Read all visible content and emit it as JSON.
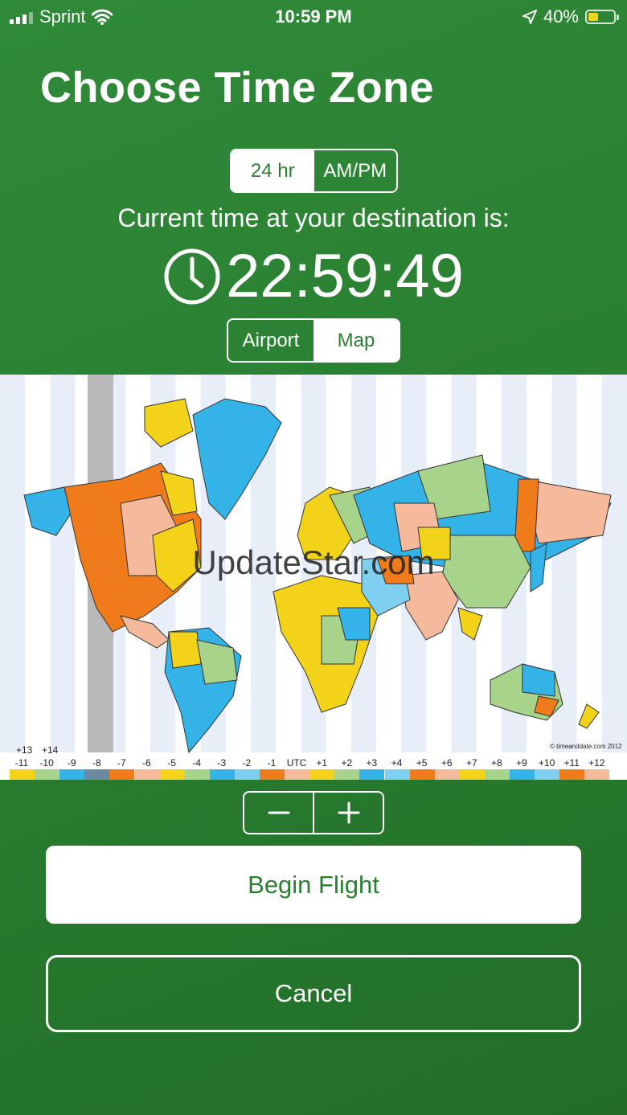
{
  "status_bar": {
    "carrier": "Sprint",
    "time": "10:59 PM",
    "battery_percent": "40%",
    "battery_level": 0.4,
    "icons": [
      "signal-bars-icon",
      "wifi-icon",
      "location-arrow-icon",
      "battery-icon"
    ]
  },
  "title": "Choose Time Zone",
  "format_toggle": {
    "options": [
      "24 hr",
      "AM/PM"
    ],
    "selected": "24 hr"
  },
  "destination_label": "Current time at your destination is:",
  "current_time": "22:59:49",
  "source_toggle": {
    "options": [
      "Airport",
      "Map"
    ],
    "selected": "Map"
  },
  "map": {
    "watermark": "UpdateStar.com",
    "credit": "© timeanddate.com 2012",
    "extra_offsets": [
      "+13",
      "+14"
    ],
    "offsets": [
      "-11",
      "-10",
      "-9",
      "-8",
      "-7",
      "-6",
      "-5",
      "-4",
      "-3",
      "-2",
      "-1",
      "UTC",
      "+1",
      "+2",
      "+3",
      "+4",
      "+5",
      "+6",
      "+7",
      "+8",
      "+9",
      "+10",
      "+11",
      "+12"
    ],
    "offset_colors": [
      "#f3d21a",
      "#a7d38a",
      "#33b3e8",
      "#6b8aa0",
      "#ef7b1a",
      "#f5b99b",
      "#f3d21a",
      "#a7d38a",
      "#33b3e8",
      "#7fcff0",
      "#ef7b1a",
      "#f5b99b",
      "#f3d21a",
      "#a7d38a",
      "#33b3e8",
      "#7fcff0",
      "#ef7b1a",
      "#f5b99b",
      "#f3d21a",
      "#a7d38a",
      "#33b3e8",
      "#7fcff0",
      "#ef7b1a",
      "#f5b99b"
    ],
    "selected_offset": "-8"
  },
  "stepper": {
    "minus_icon": "minus-icon",
    "plus_icon": "plus-icon"
  },
  "primary_button": "Begin Flight",
  "secondary_button": "Cancel",
  "colors": {
    "background": "#2a7f31",
    "accent_text": "#2a7f31"
  }
}
